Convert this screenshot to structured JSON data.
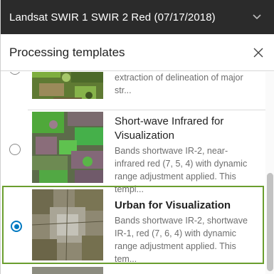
{
  "topbar": {
    "title": "Landsat SWIR 1 SWIR 2 Red (07/17/2018)",
    "chevron_icon": "chevron-down-icon"
  },
  "panel": {
    "title": "Processing templates",
    "close_icon": "close-icon"
  },
  "templates": [
    {
      "title": "",
      "description": "enables easier visualization and extraction of delineation of major str...",
      "selected": false
    },
    {
      "title": "Short-wave Infrared for Visualization",
      "description": "Bands shortwave IR-2, near-infrared red (7, 5, 4) with dynamic range adjustment applied. This templ...",
      "selected": false
    },
    {
      "title": "Urban for Visualization",
      "description": "Bands shortwave IR-2, shortwave IR-1, red (7, 6, 4) with dynamic range adjustment applied. This tem...",
      "selected": true
    }
  ],
  "colors": {
    "header_bg": "#2b2b2b",
    "accent_blue": "#0079c1",
    "selected_border": "#6a9e2e"
  }
}
